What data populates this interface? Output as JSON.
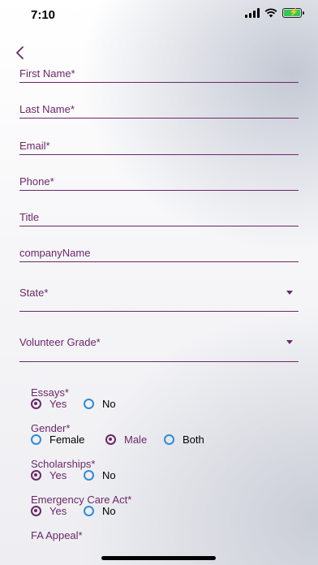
{
  "status": {
    "time": "7:10"
  },
  "form": {
    "first_name_label": "First Name*",
    "last_name_label": "Last Name*",
    "email_label": "Email*",
    "phone_label": "Phone*",
    "title_label": "Title",
    "company_label": "companyName",
    "state_label": "State*",
    "volunteer_grade_label": "Volunteer Grade*"
  },
  "radio_groups": {
    "essays": {
      "label": "Essays*",
      "options": [
        "Yes",
        "No"
      ],
      "selected": "Yes"
    },
    "gender": {
      "label": "Gender*",
      "options": [
        "Female",
        "Male",
        "Both"
      ],
      "selected": "Male"
    },
    "scholarships": {
      "label": "Scholarships*",
      "options": [
        "Yes",
        "No"
      ],
      "selected": "Yes"
    },
    "emergency": {
      "label": "Emergency Care Act*",
      "options": [
        "Yes",
        "No"
      ],
      "selected": "Yes"
    },
    "fa_appeal": {
      "label": "FA Appeal*"
    }
  },
  "colors": {
    "accent": "#6b2769",
    "radio_unselected": "#2e8cd9"
  }
}
